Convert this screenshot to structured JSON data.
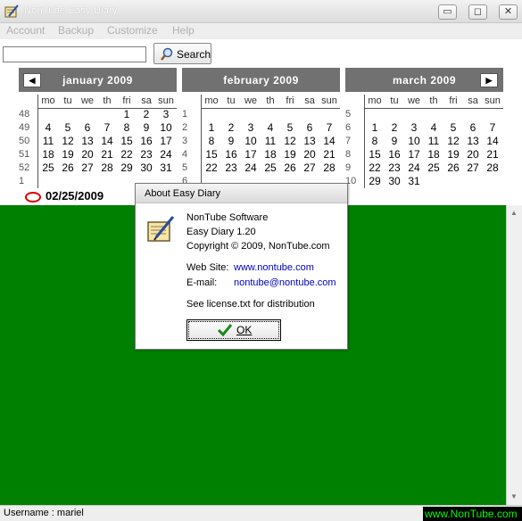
{
  "window": {
    "title": "NonTube Easy Diary",
    "minimize_glyph": "▭",
    "maximize_glyph": "◻",
    "close_glyph": "✕"
  },
  "menu": [
    "Account",
    "Backup",
    "Customize",
    "Help"
  ],
  "search": {
    "value": "",
    "button_label": "Search"
  },
  "calendar": {
    "day_headers": [
      "mo",
      "tu",
      "we",
      "th",
      "fri",
      "sa",
      "sun"
    ],
    "months": [
      {
        "title": "january  2009",
        "weeks": [
          "48",
          "49",
          "50",
          "51",
          "52",
          "1"
        ],
        "rows": [
          [
            "",
            "",
            "",
            "",
            "1",
            "2",
            "3"
          ],
          [
            "4",
            "5",
            "6",
            "7",
            "8",
            "9",
            "10"
          ],
          [
            "11",
            "12",
            "13",
            "14",
            "15",
            "16",
            "17"
          ],
          [
            "18",
            "19",
            "20",
            "21",
            "22",
            "23",
            "24"
          ],
          [
            "25",
            "26",
            "27",
            "28",
            "29",
            "30",
            "31"
          ],
          [
            "",
            "",
            "",
            "",
            "",
            "",
            ""
          ]
        ]
      },
      {
        "title": "february  2009",
        "weeks": [
          "1",
          "2",
          "3",
          "4",
          "5",
          "6"
        ],
        "rows": [
          [
            "",
            "",
            "",
            "",
            "",
            "",
            ""
          ],
          [
            "1",
            "2",
            "3",
            "4",
            "5",
            "6",
            "7"
          ],
          [
            "8",
            "9",
            "10",
            "11",
            "12",
            "13",
            "14"
          ],
          [
            "15",
            "16",
            "17",
            "18",
            "19",
            "20",
            "21"
          ],
          [
            "22",
            "23",
            "24",
            "25",
            "26",
            "27",
            "28"
          ],
          [
            "",
            "",
            "",
            "",
            "",
            "",
            ""
          ]
        ]
      },
      {
        "title": "march  2009",
        "weeks": [
          "5",
          "6",
          "7",
          "8",
          "9",
          "10"
        ],
        "rows": [
          [
            "",
            "",
            "",
            "",
            "",
            "",
            ""
          ],
          [
            "1",
            "2",
            "3",
            "4",
            "5",
            "6",
            "7"
          ],
          [
            "8",
            "9",
            "10",
            "11",
            "12",
            "13",
            "14"
          ],
          [
            "15",
            "16",
            "17",
            "18",
            "19",
            "20",
            "21"
          ],
          [
            "22",
            "23",
            "24",
            "25",
            "26",
            "27",
            "28"
          ],
          [
            "29",
            "30",
            "31",
            "",
            "",
            "",
            ""
          ]
        ]
      }
    ],
    "prev_glyph": "◀",
    "next_glyph": "▶",
    "selected_date": "02/25/2009"
  },
  "about_dialog": {
    "title": "About Easy Diary",
    "company": "NonTube Software",
    "product": "Easy Diary 1.20",
    "copyright": "Copyright © 2009, NonTube.com",
    "website_label": "Web Site:",
    "website_value": "www.nontube.com",
    "email_label": "E-mail:",
    "email_value": "nontube@nontube.com",
    "license_note": "See license.txt for distribution",
    "ok_label": "OK"
  },
  "status": {
    "user": "Username : mariel",
    "site": "www.NonTube.com"
  },
  "colors": {
    "editor_bg": "#008000",
    "month_header": "#717171",
    "status_site_text": "#00ff00"
  }
}
